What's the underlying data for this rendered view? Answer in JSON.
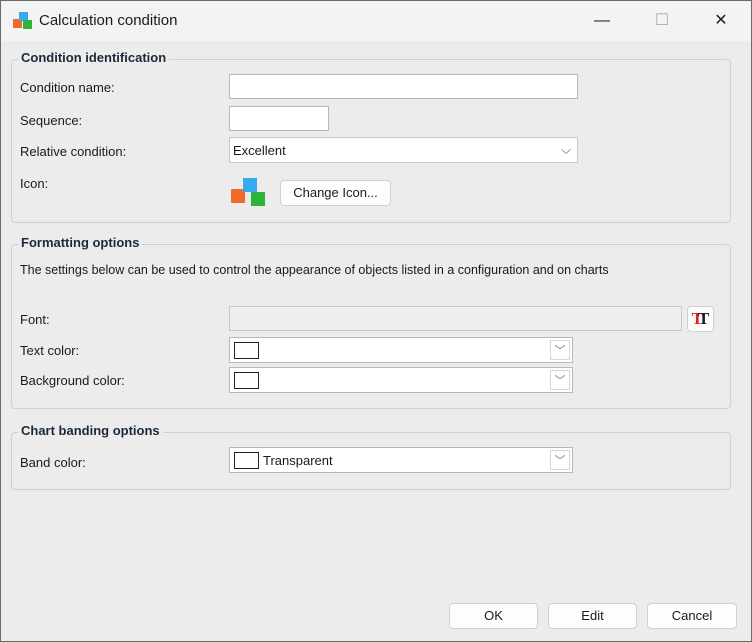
{
  "window": {
    "title": "Calculation condition",
    "minimize": "—",
    "maximize": "☐",
    "close": "✕"
  },
  "identification": {
    "title": "Condition identification",
    "name_label": "Condition name:",
    "name_value": "",
    "sequence_label": "Sequence:",
    "sequence_value": "",
    "relative_label": "Relative condition:",
    "relative_value": "Excellent",
    "icon_label": "Icon:",
    "change_icon": "Change Icon..."
  },
  "formatting": {
    "title": "Formatting options",
    "description": "The settings below can be used to control the appearance of objects listed in a configuration and on charts",
    "font_label": "Font:",
    "font_value": "",
    "text_color_label": "Text color:",
    "bg_color_label": "Background color:"
  },
  "banding": {
    "title": "Chart banding options",
    "band_label": "Band color:",
    "band_value": "Transparent"
  },
  "buttons": {
    "ok": "OK",
    "edit": "Edit",
    "cancel": "Cancel"
  }
}
